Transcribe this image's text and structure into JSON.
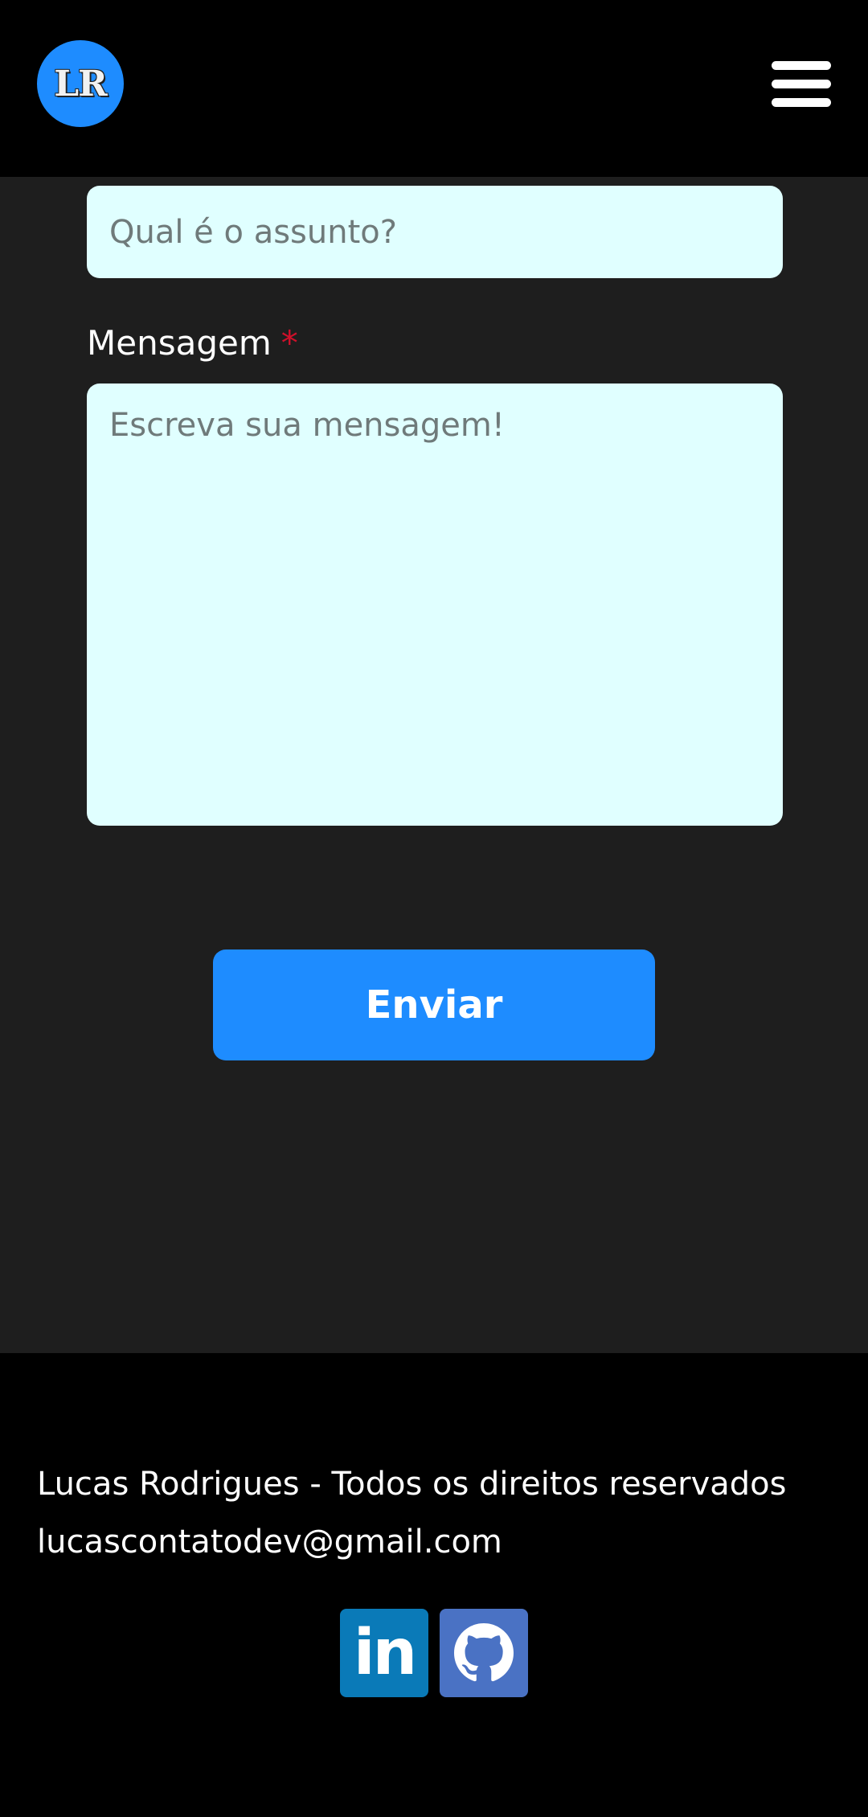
{
  "header": {
    "logo_text": "LR",
    "menu_icon": "hamburger-menu-icon"
  },
  "form": {
    "subject_placeholder": "Qual é o assunto?",
    "message_label": "Mensagem",
    "required_marker": "*",
    "message_placeholder": "Escreva sua mensagem!",
    "submit_label": "Enviar"
  },
  "footer": {
    "copyright": "Lucas Rodrigues - Todos os direitos reservados",
    "email": "lucascontatodev@gmail.com",
    "social": [
      {
        "icon": "linkedin-icon",
        "text": "in",
        "color": "#0a7ab8"
      },
      {
        "icon": "github-icon",
        "color": "#4a72c4"
      }
    ]
  },
  "colors": {
    "accent": "#1e8cff",
    "background": "#1e1e1e",
    "header_footer": "#000000",
    "input_bg": "#e0ffff",
    "required": "#d0102a"
  }
}
